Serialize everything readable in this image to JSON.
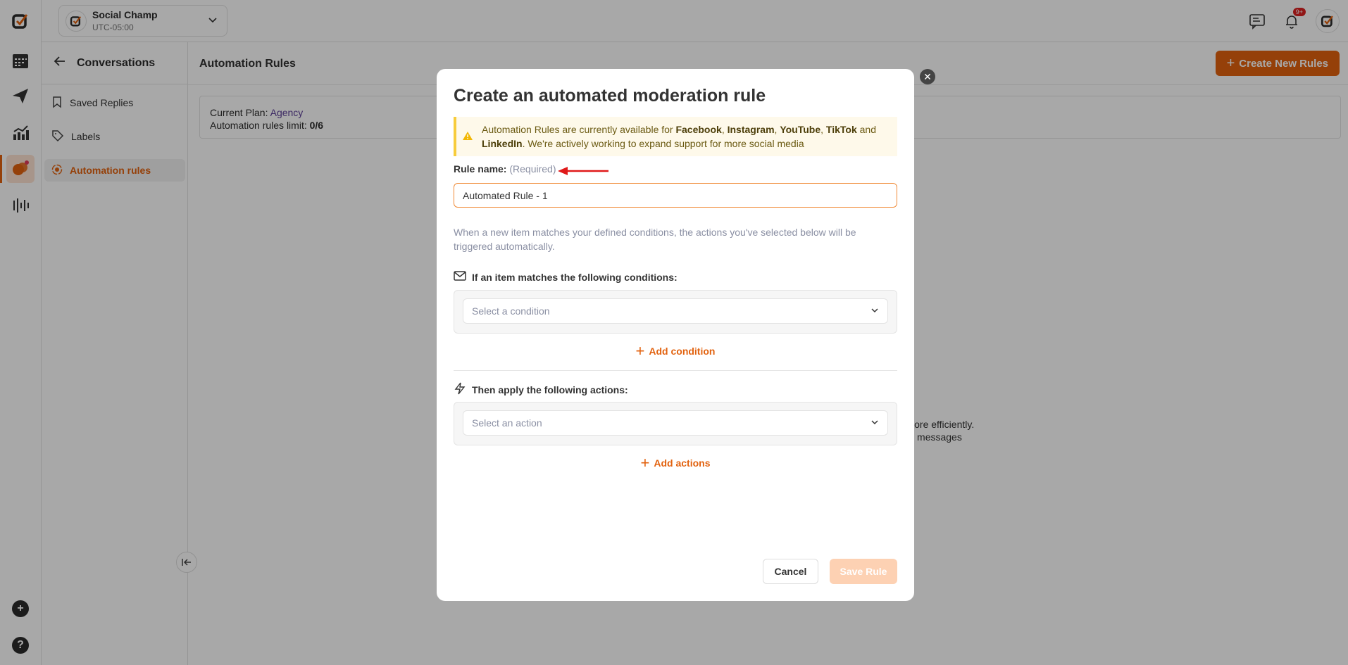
{
  "workspace": {
    "name": "Social Champ",
    "timezone": "UTC-05:00"
  },
  "topbar": {
    "notifications_badge": "9+"
  },
  "subnav": {
    "title": "Conversations",
    "items": [
      {
        "label": "Saved Replies",
        "icon": "bookmark-icon",
        "active": false
      },
      {
        "label": "Labels",
        "icon": "tag-icon",
        "active": false
      },
      {
        "label": "Automation rules",
        "icon": "automation-icon",
        "active": true
      }
    ]
  },
  "main": {
    "title": "Automation Rules",
    "create_button": "Create New Rules",
    "plan_label": "Current Plan:",
    "plan_value": "Agency",
    "limit_label": "Automation rules limit:",
    "limit_value": "0/6",
    "bg_text_line1": "ges more efficiently.",
    "bg_text_line2": "ion on messages"
  },
  "modal": {
    "title": "Create an automated moderation rule",
    "warning": {
      "prefix": "Automation Rules are currently available for",
      "platforms": [
        "Facebook",
        "Instagram",
        "YouTube",
        "TikTok",
        "LinkedIn"
      ],
      "and": "and",
      "suffix": ". We're actively working to expand support for more social media"
    },
    "rule_name_label": "Rule name:",
    "rule_name_required": "(Required)",
    "rule_name_value": "Automated Rule - 1",
    "description": "When a new item matches your defined conditions, the actions you've selected below will be triggered automatically.",
    "conditions_heading": "If an item matches the following conditions:",
    "condition_placeholder": "Select a condition",
    "add_condition": "Add condition",
    "actions_heading": "Then apply the following actions:",
    "action_placeholder": "Select an action",
    "add_actions": "Add actions",
    "cancel": "Cancel",
    "save": "Save Rule"
  },
  "colors": {
    "accent": "#e2620f",
    "warning_border": "#f7cc3b",
    "warning_bg": "#fef9ea",
    "plan": "#5b3e97"
  }
}
